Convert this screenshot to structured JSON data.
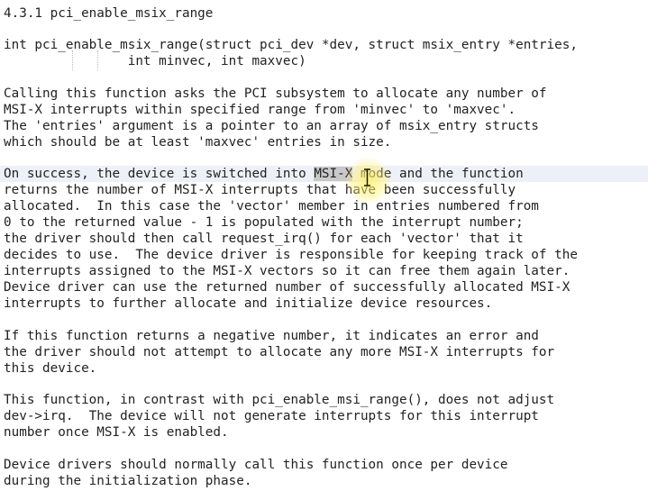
{
  "document": {
    "heading": "4.3.1 pci_enable_msix_range",
    "signature": [
      "int pci_enable_msix_range(struct pci_dev *dev, struct msix_entry *entries,",
      "                int minvec, int maxvec)"
    ],
    "para1": [
      "Calling this function asks the PCI subsystem to allocate any number of",
      "MSI-X interrupts within specified range from 'minvec' to 'maxvec'.",
      "The 'entries' argument is a pointer to an array of msix_entry structs",
      "which should be at least 'maxvec' entries in size."
    ],
    "para2_first": {
      "before": "On success, the device is switched into ",
      "selected": "MSI-X",
      "after": " mode and the function"
    },
    "para2_rest": [
      "returns the number of MSI-X interrupts that have been successfully",
      "allocated.  In this case the 'vector' member in entries numbered from",
      "0 to the returned value - 1 is populated with the interrupt number;",
      "the driver should then call request_irq() for each 'vector' that it",
      "decides to use.  The device driver is responsible for keeping track of the",
      "interrupts assigned to the MSI-X vectors so it can free them again later.",
      "Device driver can use the returned number of successfully allocated MSI-X",
      "interrupts to further allocate and initialize device resources."
    ],
    "para3": [
      "If this function returns a negative number, it indicates an error and",
      "the driver should not attempt to allocate any more MSI-X interrupts for",
      "this device."
    ],
    "para4": [
      "This function, in contrast with pci_enable_msi_range(), does not adjust",
      "dev->irq.  The device will not generate interrupts for this interrupt",
      "number once MSI-X is enabled."
    ],
    "para5": [
      "Device drivers should normally call this function once per device",
      "during the initialization phase."
    ]
  },
  "colors": {
    "text": "#222222",
    "selection": "#c9c9c9",
    "current_line": "#eef0f8",
    "cursor_highlight": "#fff05a"
  },
  "icons": {
    "cursor": "text-cursor-icon"
  }
}
